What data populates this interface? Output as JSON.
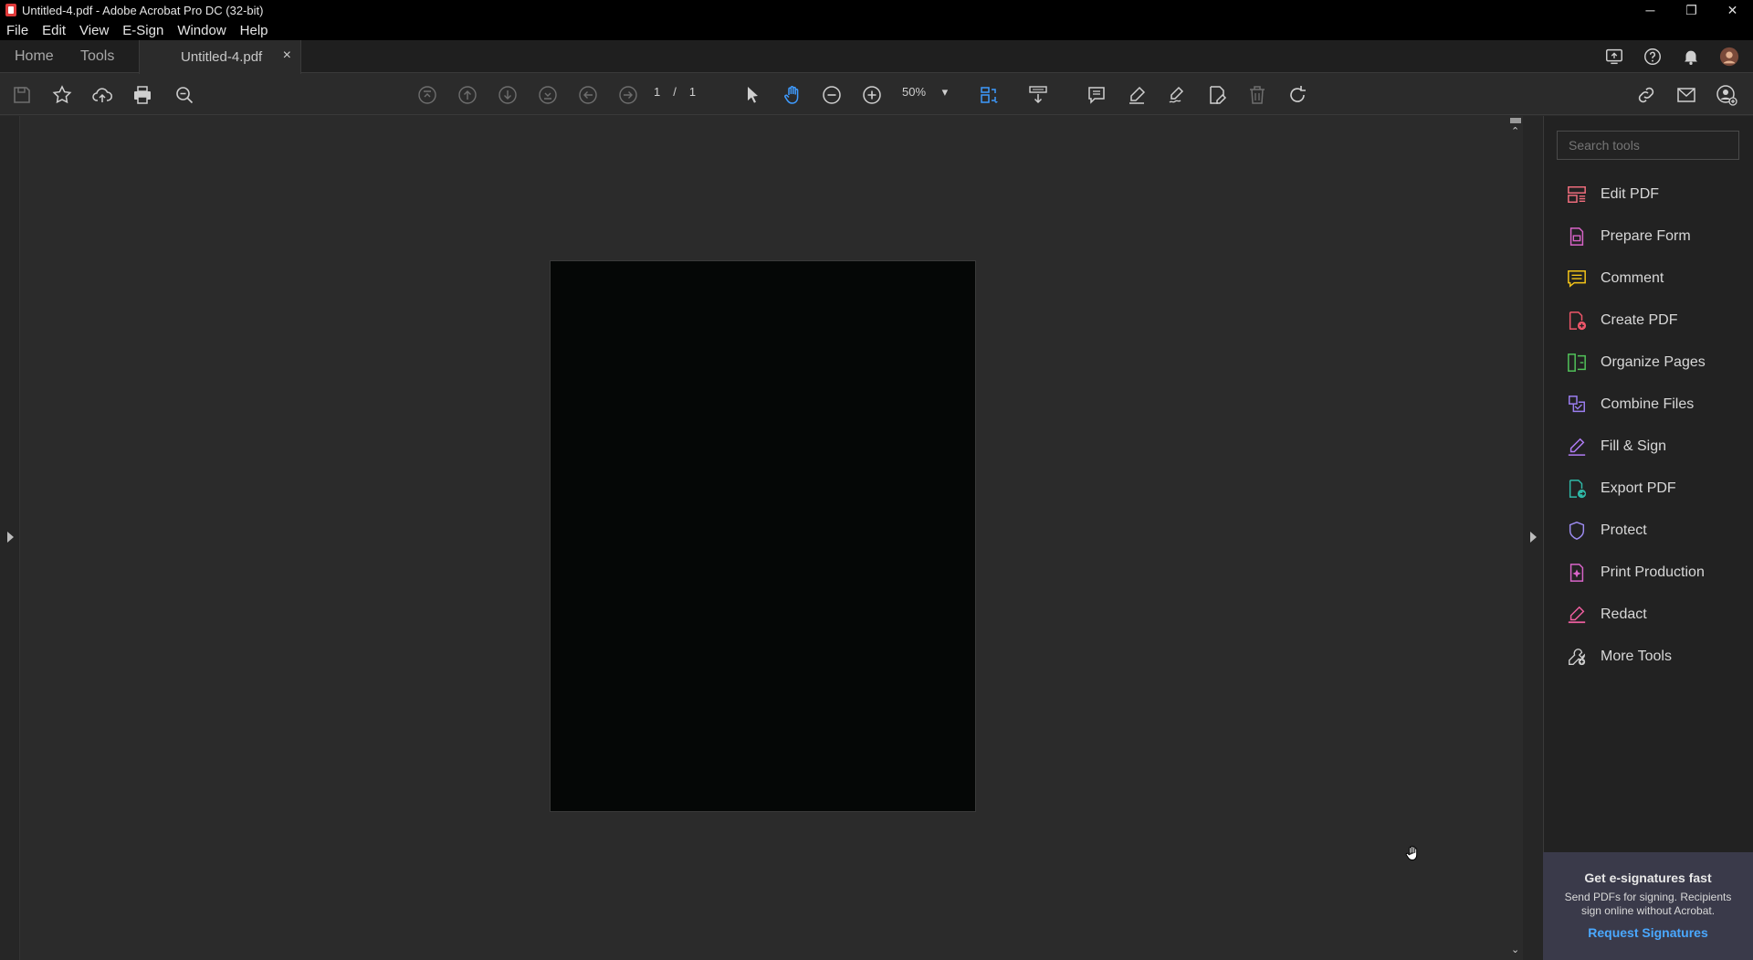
{
  "window": {
    "title": "Untitled-4.pdf - Adobe Acrobat Pro DC (32-bit)",
    "controls": {
      "minimize": "─",
      "restore": "❐",
      "close": "✕"
    }
  },
  "menu": {
    "items": [
      "File",
      "Edit",
      "View",
      "E-Sign",
      "Window",
      "Help"
    ]
  },
  "tabs": {
    "home": "Home",
    "tools": "Tools",
    "document": "Untitled-4.pdf",
    "close_symbol": "×"
  },
  "toolbar": {
    "page_current": "1",
    "page_separator": "/",
    "page_total": "1",
    "zoom": "50%",
    "zoom_caret": "▾"
  },
  "right_pane": {
    "search_placeholder": "Search tools",
    "tools": [
      {
        "label": "Edit PDF",
        "icon": "edit-pdf-icon",
        "color": "#f26e7e"
      },
      {
        "label": "Prepare Form",
        "icon": "prepare-form-icon",
        "color": "#d964c9"
      },
      {
        "label": "Comment",
        "icon": "comment-icon",
        "color": "#f5c518"
      },
      {
        "label": "Create PDF",
        "icon": "create-pdf-icon",
        "color": "#f0566a"
      },
      {
        "label": "Organize Pages",
        "icon": "organize-pages-icon",
        "color": "#52c45a"
      },
      {
        "label": "Combine Files",
        "icon": "combine-files-icon",
        "color": "#9b7ef0"
      },
      {
        "label": "Fill & Sign",
        "icon": "fill-sign-icon",
        "color": "#b07cf5"
      },
      {
        "label": "Export PDF",
        "icon": "export-pdf-icon",
        "color": "#2fb9a7"
      },
      {
        "label": "Protect",
        "icon": "protect-icon",
        "color": "#9d8cf2"
      },
      {
        "label": "Print Production",
        "icon": "print-production-icon",
        "color": "#d964c9"
      },
      {
        "label": "Redact",
        "icon": "redact-icon",
        "color": "#f05fa0"
      },
      {
        "label": "More Tools",
        "icon": "more-tools-icon",
        "color": "#cfcfcf"
      }
    ]
  },
  "promo": {
    "heading": "Get e-signatures fast",
    "body": "Send PDFs for signing. Recipients sign online without Acrobat.",
    "link": "Request Signatures"
  },
  "colors": {
    "accent_blue": "#3e9bff",
    "background": "#2b2b2b",
    "page": "#050706"
  }
}
